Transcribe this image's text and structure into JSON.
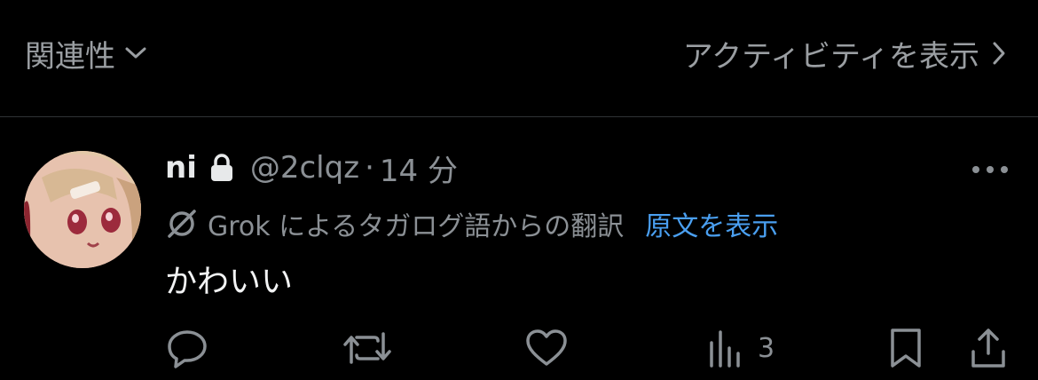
{
  "topbar": {
    "sort_label": "関連性",
    "activity_label": "アクティビティを表示"
  },
  "reply": {
    "display_name": "ni",
    "handle": "@2clqz",
    "separator": "·",
    "time_ago": "14 分",
    "translation_note": "Grok によるタガログ語からの翻訳",
    "show_original_label": "原文を表示",
    "text": "かわいい",
    "views_count": "3"
  },
  "colors": {
    "background": "#000000",
    "primary_text": "#e7e9ea",
    "secondary_text": "#8b9095",
    "link": "#4a9ff0",
    "divider": "#2f3336"
  },
  "icons": {
    "sort_chevron": "chevron-down-icon",
    "activity_chevron": "chevron-right-icon",
    "protected": "lock-icon",
    "translation": "grok-icon",
    "more": "more-horizontal-icon",
    "reply": "reply-icon",
    "repost": "repost-icon",
    "like": "heart-icon",
    "views": "views-chart-icon",
    "bookmark": "bookmark-icon",
    "share": "share-icon"
  }
}
